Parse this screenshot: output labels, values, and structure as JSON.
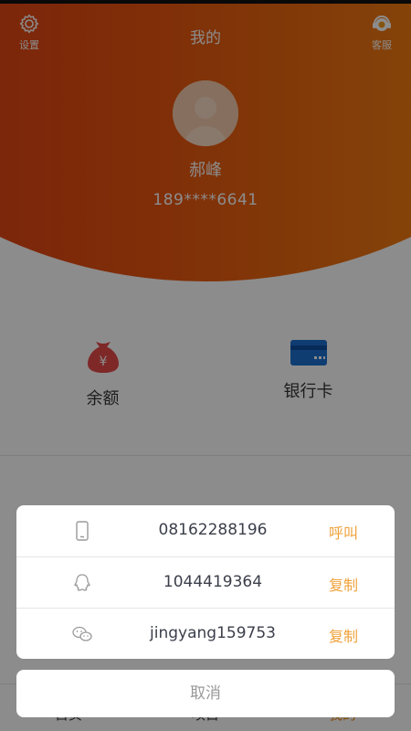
{
  "header": {
    "settings_label": "设置",
    "title": "我的",
    "service_label": "客服",
    "user_name": "郝峰",
    "user_phone": "189****6641",
    "colors": {
      "gradient_start": "#d8331a",
      "gradient_end": "#f29a1c"
    }
  },
  "quick": {
    "balance_label": "余额",
    "card_label": "银行卡",
    "icons": {
      "balance": "money-bag-icon",
      "card": "bank-card-icon"
    }
  },
  "tabbar": {
    "tabs": [
      "首页",
      "项目",
      "我的"
    ],
    "active_color": "#f08a16"
  },
  "contact_sheet": {
    "rows": [
      {
        "icon": "phone-icon",
        "value": "08162288196",
        "action": "呼叫"
      },
      {
        "icon": "qq-icon",
        "value": "1044419364",
        "action": "复制"
      },
      {
        "icon": "wechat-icon",
        "value": "jingyang159753",
        "action": "复制"
      }
    ],
    "cancel_label": "取消",
    "action_color": "#f0a23c"
  }
}
